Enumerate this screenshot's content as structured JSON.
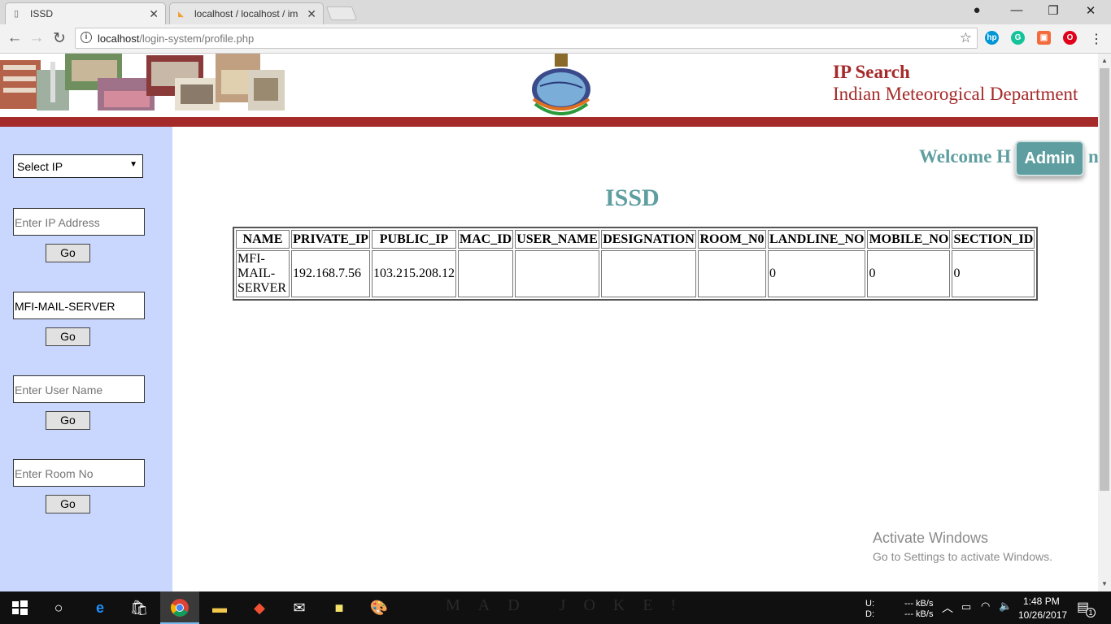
{
  "browser": {
    "tabs": [
      {
        "title": "ISSD",
        "active": true
      },
      {
        "title": "localhost / localhost / im",
        "active": false
      }
    ],
    "url_host": "localhost",
    "url_path": "/login-system/profile.php"
  },
  "header": {
    "title": "IP Search",
    "subtitle": "Indian Meteorogical Department"
  },
  "sidebar": {
    "select_label": "Select IP",
    "ip_placeholder": "Enter IP Address",
    "name_value": "MFI-MAIL-SERVER",
    "user_placeholder": "Enter User Name",
    "room_placeholder": "Enter Room No",
    "go_label": "Go"
  },
  "main": {
    "welcome": "Welcome H",
    "welcome_tail": "n",
    "admin_label": "Admin",
    "page_title": "ISSD",
    "table": {
      "headers": [
        "NAME",
        "PRIVATE_IP",
        "PUBLIC_IP",
        "MAC_ID",
        "USER_NAME",
        "DESIGNATION",
        "ROOM_N0",
        "LANDLINE_NO",
        "MOBILE_NO",
        "SECTION_ID"
      ],
      "row": [
        "MFI-\nMAIL-\nSERVER",
        "192.168.7.56",
        "103.215.208.12",
        "",
        "",
        "",
        "",
        "0",
        "0",
        "0"
      ]
    }
  },
  "watermark": {
    "line1": "Activate Windows",
    "line2": "Go to Settings to activate Windows."
  },
  "taskbar": {
    "wallpaper_text": "MAD JOKE!",
    "net_up_label": "U:",
    "net_down_label": "D:",
    "net_up": "--- kB/s",
    "net_down": "--- kB/s",
    "time": "1:48 PM",
    "date": "10/26/2017",
    "notifications": "1"
  }
}
